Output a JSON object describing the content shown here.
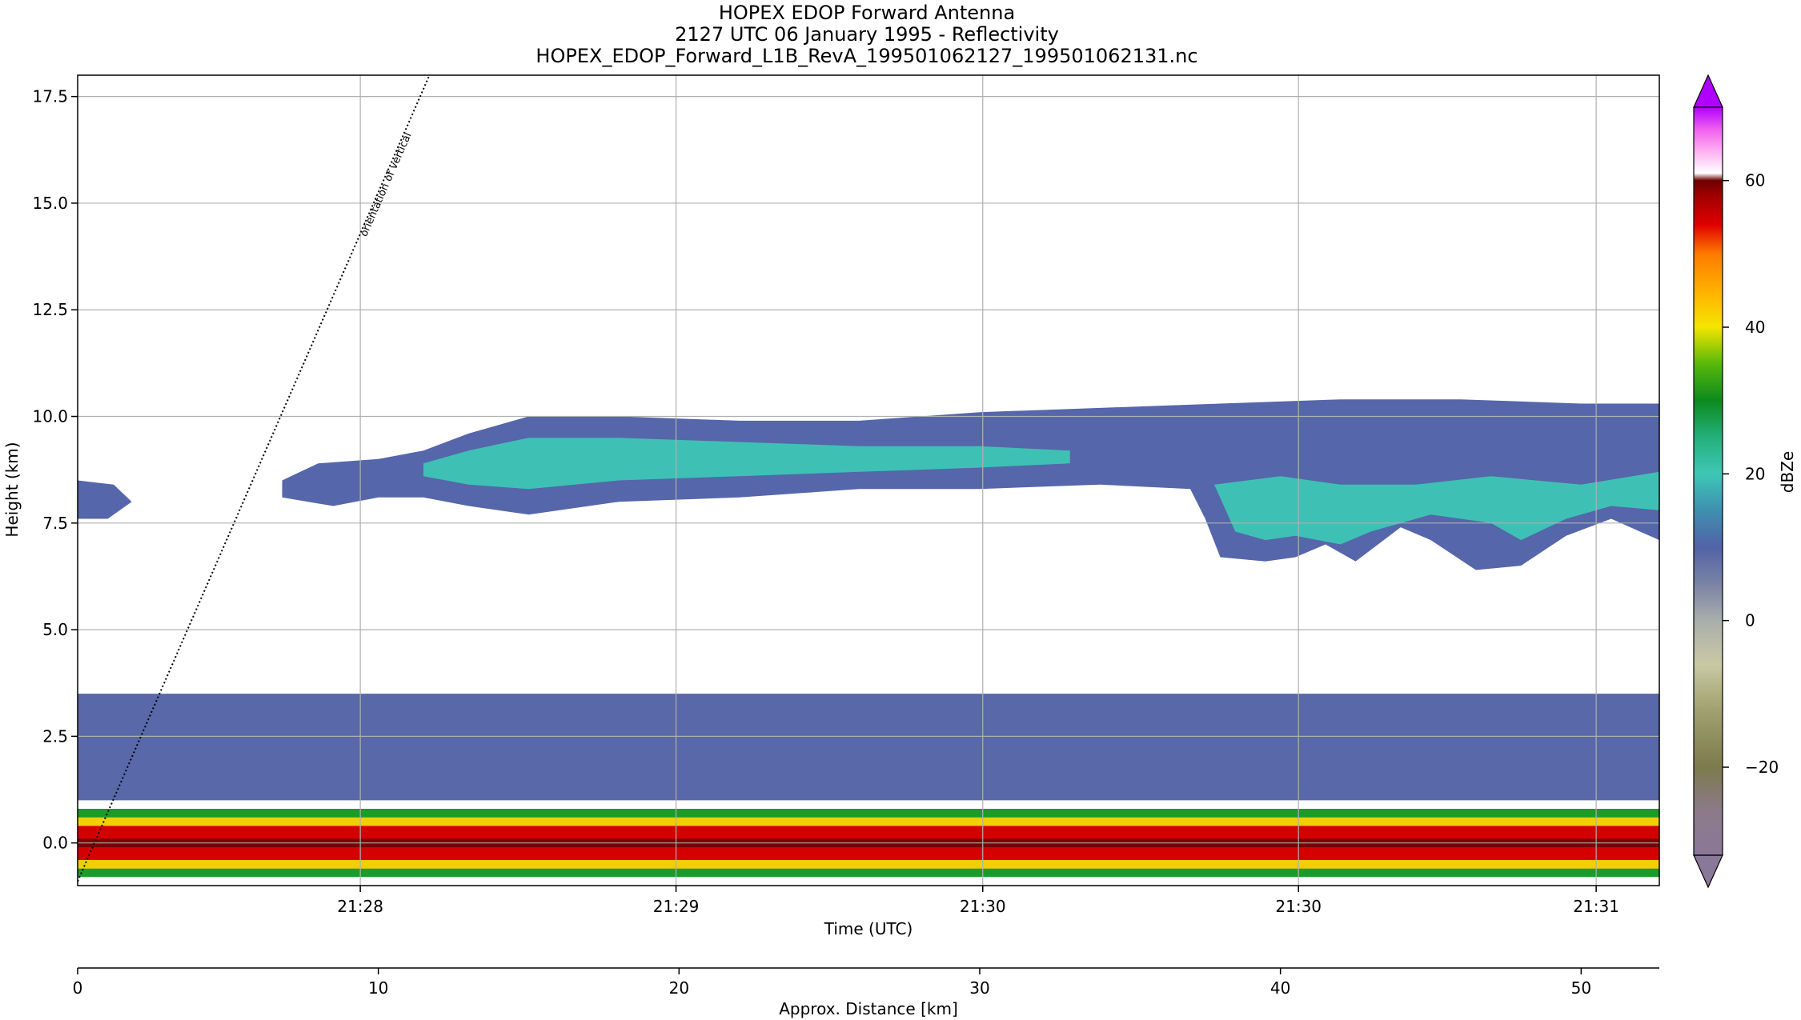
{
  "chart_data": {
    "type": "heatmap",
    "title_lines": [
      "HOPEX EDOP Forward Antenna",
      "2127 UTC 06 January 1995 - Reflectivity",
      "HOPEX_EDOP_Forward_L1B_RevA_199501062127_199501062131.nc"
    ],
    "ylabel": "Height (km)",
    "xlabel": "Time (UTC)",
    "x2label": "Approx. Distance [km]",
    "ylim": [
      -1.0,
      18.0
    ],
    "y_ticks": [
      0.0,
      2.5,
      5.0,
      7.5,
      10.0,
      12.5,
      15.0,
      17.5
    ],
    "y_tick_labels": [
      "0.0",
      "2.5",
      "5.0",
      "7.5",
      "10.0",
      "12.5",
      "15.0",
      "17.5"
    ],
    "x_range_km": [
      0,
      52.6
    ],
    "time_ticks_km": [
      9.4,
      19.9,
      30.1,
      40.6,
      50.5
    ],
    "time_tick_labels": [
      "21:28",
      "21:29",
      "21:30",
      "21:30",
      "21:31"
    ],
    "distance_ticks": [
      0,
      10,
      20,
      30,
      40,
      50
    ],
    "distance_tick_labels": [
      "0",
      "10",
      "20",
      "30",
      "40",
      "50"
    ],
    "grid": true,
    "annotation": "orientation of vertical",
    "vertical_line_km": [
      [
        0,
        -0.9
      ],
      [
        11.7,
        18.0
      ]
    ],
    "colorbar": {
      "label": "dBZe",
      "range": [
        -32,
        70
      ],
      "ticks": [
        -20,
        0,
        20,
        40,
        60
      ],
      "tick_labels": [
        "−20",
        "0",
        "20",
        "40",
        "60"
      ],
      "stops": [
        {
          "v": -32,
          "color": "#8a7898"
        },
        {
          "v": -26,
          "color": "#8c7a8a"
        },
        {
          "v": -20,
          "color": "#7d7a4d"
        },
        {
          "v": -12,
          "color": "#a2a271"
        },
        {
          "v": -6,
          "color": "#c9c9a4"
        },
        {
          "v": 0,
          "color": "#a9aeac"
        },
        {
          "v": 5,
          "color": "#7a83a5"
        },
        {
          "v": 10,
          "color": "#5263a7"
        },
        {
          "v": 15,
          "color": "#3f8fb0"
        },
        {
          "v": 20,
          "color": "#3ec7b5"
        },
        {
          "v": 25,
          "color": "#24b07a"
        },
        {
          "v": 30,
          "color": "#0c8a1e"
        },
        {
          "v": 35,
          "color": "#58b80a"
        },
        {
          "v": 40,
          "color": "#f5e500"
        },
        {
          "v": 45,
          "color": "#ffb000"
        },
        {
          "v": 50,
          "color": "#ff7a00"
        },
        {
          "v": 54,
          "color": "#e00000"
        },
        {
          "v": 58,
          "color": "#a00000"
        },
        {
          "v": 60,
          "color": "#6e0000"
        },
        {
          "v": 61,
          "color": "#ffffff"
        },
        {
          "v": 64,
          "color": "#ffb0f0"
        },
        {
          "v": 67,
          "color": "#f060f0"
        },
        {
          "v": 70,
          "color": "#b000ff"
        }
      ]
    },
    "echo_layers": [
      {
        "name": "anvil",
        "color": "#5566aa",
        "points": [
          [
            6.8,
            8.5
          ],
          [
            8,
            8.9
          ],
          [
            10,
            9.0
          ],
          [
            11.5,
            9.2
          ],
          [
            13,
            9.6
          ],
          [
            15,
            10.0
          ],
          [
            18,
            10.0
          ],
          [
            22,
            9.9
          ],
          [
            26,
            9.9
          ],
          [
            30,
            10.1
          ],
          [
            34,
            10.2
          ],
          [
            38,
            10.3
          ],
          [
            42,
            10.4
          ],
          [
            46,
            10.4
          ],
          [
            50,
            10.3
          ],
          [
            52.6,
            10.3
          ],
          [
            52.6,
            7.1
          ],
          [
            51,
            7.6
          ],
          [
            49.5,
            7.2
          ],
          [
            48,
            6.5
          ],
          [
            46.5,
            6.4
          ],
          [
            45,
            7.1
          ],
          [
            44,
            7.4
          ],
          [
            42.5,
            6.6
          ],
          [
            41.5,
            7.0
          ],
          [
            40.5,
            6.7
          ],
          [
            39.5,
            6.6
          ],
          [
            38,
            6.7
          ],
          [
            37.5,
            7.6
          ],
          [
            37,
            8.3
          ],
          [
            34,
            8.4
          ],
          [
            30,
            8.3
          ],
          [
            26,
            8.3
          ],
          [
            22,
            8.1
          ],
          [
            18,
            8.0
          ],
          [
            15,
            7.7
          ],
          [
            13,
            7.9
          ],
          [
            11.5,
            8.1
          ],
          [
            10,
            8.1
          ],
          [
            8.5,
            7.9
          ],
          [
            6.8,
            8.1
          ]
        ]
      },
      {
        "name": "anvil-core",
        "color": "#3ec1b4",
        "points": [
          [
            11.5,
            8.9
          ],
          [
            13,
            9.2
          ],
          [
            15,
            9.5
          ],
          [
            18,
            9.5
          ],
          [
            22,
            9.4
          ],
          [
            26,
            9.3
          ],
          [
            30,
            9.3
          ],
          [
            33,
            9.2
          ],
          [
            33,
            8.9
          ],
          [
            30,
            8.8
          ],
          [
            26,
            8.7
          ],
          [
            22,
            8.6
          ],
          [
            18,
            8.5
          ],
          [
            15,
            8.3
          ],
          [
            13,
            8.4
          ],
          [
            11.5,
            8.6
          ]
        ]
      },
      {
        "name": "lower-streak-1",
        "color": "#3ec1b4",
        "points": [
          [
            37.8,
            8.4
          ],
          [
            40,
            8.6
          ],
          [
            42,
            8.4
          ],
          [
            44.5,
            8.4
          ],
          [
            47,
            8.6
          ],
          [
            50,
            8.4
          ],
          [
            52.6,
            8.7
          ],
          [
            52.6,
            7.8
          ],
          [
            51,
            7.9
          ],
          [
            49.5,
            7.6
          ],
          [
            48,
            7.1
          ],
          [
            47,
            7.5
          ],
          [
            45,
            7.7
          ],
          [
            43,
            7.3
          ],
          [
            42,
            7.0
          ],
          [
            40.5,
            7.2
          ],
          [
            39.5,
            7.1
          ],
          [
            38.5,
            7.3
          ]
        ]
      },
      {
        "name": "left-blob",
        "color": "#5566aa",
        "points": [
          [
            0,
            8.5
          ],
          [
            1.2,
            8.4
          ],
          [
            1.8,
            8.0
          ],
          [
            1.0,
            7.6
          ],
          [
            0,
            7.6
          ]
        ]
      },
      {
        "name": "low-layer",
        "color": "#5868a8",
        "points": [
          [
            0,
            3.5
          ],
          [
            52.6,
            3.5
          ],
          [
            52.6,
            1.0
          ],
          [
            0,
            1.0
          ]
        ]
      },
      {
        "name": "surface-green",
        "color": "#1e9a2a",
        "points": [
          [
            0,
            0.8
          ],
          [
            52.6,
            0.8
          ],
          [
            52.6,
            -0.8
          ],
          [
            0,
            -0.8
          ]
        ]
      },
      {
        "name": "surface-yellow",
        "color": "#f0d000",
        "points": [
          [
            0,
            0.6
          ],
          [
            52.6,
            0.6
          ],
          [
            52.6,
            -0.6
          ],
          [
            0,
            -0.6
          ]
        ]
      },
      {
        "name": "surface-red",
        "color": "#d40000",
        "points": [
          [
            0,
            0.4
          ],
          [
            52.6,
            0.4
          ],
          [
            52.6,
            -0.4
          ],
          [
            0,
            -0.4
          ]
        ]
      },
      {
        "name": "surface-darkred",
        "color": "#7a0000",
        "points": [
          [
            0,
            0.1
          ],
          [
            52.6,
            0.1
          ],
          [
            52.6,
            -0.1
          ],
          [
            0,
            -0.1
          ]
        ]
      }
    ]
  }
}
